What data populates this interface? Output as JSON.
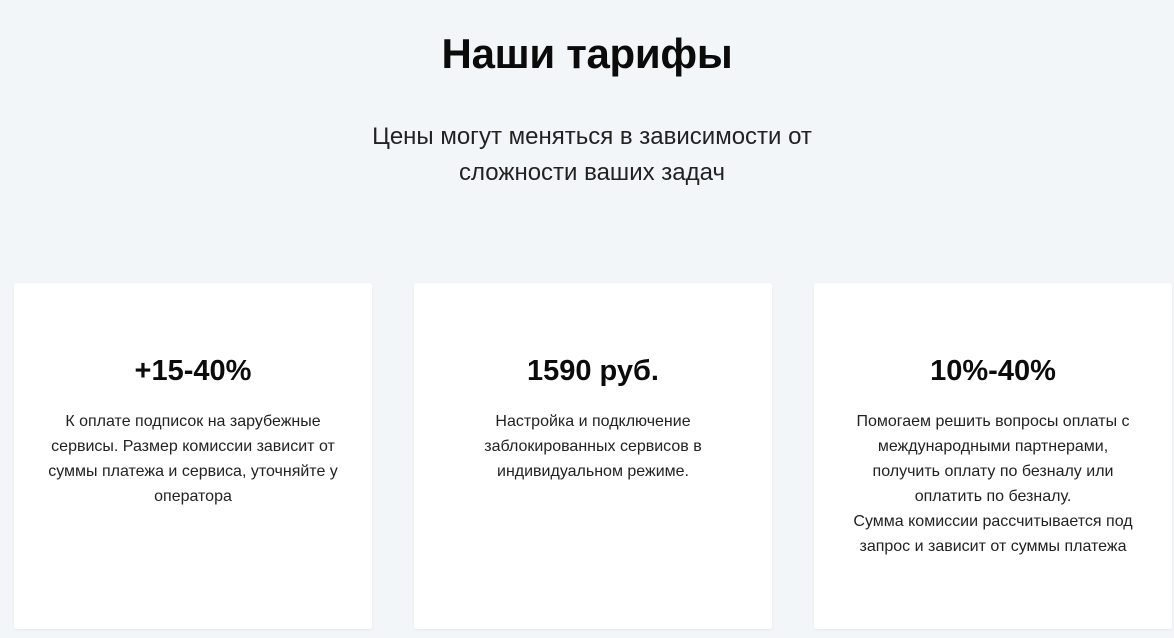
{
  "section": {
    "title": "Наши тарифы",
    "subtitle": "Цены могут меняться в зависимости от сложности ваших задач"
  },
  "tariffs": [
    {
      "price": "+15-40%",
      "description": "К оплате подписок на зарубежные сервисы. Размер комиссии зависит от суммы платежа и сервиса, уточняйте у оператора"
    },
    {
      "price": "1590 руб.",
      "description": "Настройка и подключение заблокированных сервисов в индивидуальном режиме."
    },
    {
      "price": "10%-40%",
      "description": "Помогаем решить вопросы оплаты с международными партнерами, получить оплату по безналу или оплатить по безналу.\nСумма комиссии рассчитывается под запрос и зависит от суммы платежа"
    }
  ],
  "colors": {
    "background": "#f3f6f9",
    "card": "#ffffff",
    "text": "#111111"
  }
}
